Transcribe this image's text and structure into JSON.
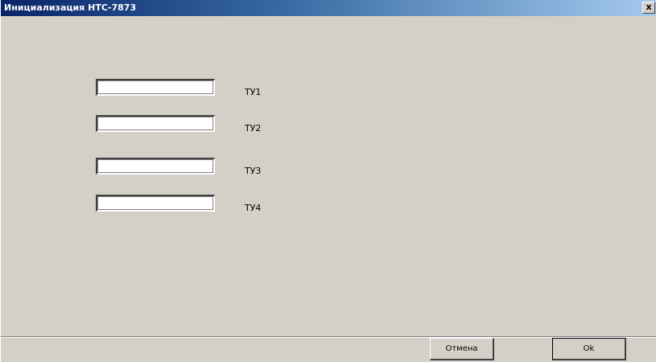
{
  "window": {
    "title": "Инициализация НТС-7873",
    "close_glyph": "x"
  },
  "fields": [
    {
      "label": "ТУ1",
      "value": ""
    },
    {
      "label": "ТУ2",
      "value": ""
    },
    {
      "label": "ТУ3",
      "value": ""
    },
    {
      "label": "ТУ4",
      "value": ""
    }
  ],
  "buttons": {
    "cancel_label": "Отмена",
    "ok_label": "Ok"
  },
  "colors": {
    "dialog_face": "#d4d0c8",
    "title_start": "#0a246a",
    "title_end": "#a6caf0"
  }
}
